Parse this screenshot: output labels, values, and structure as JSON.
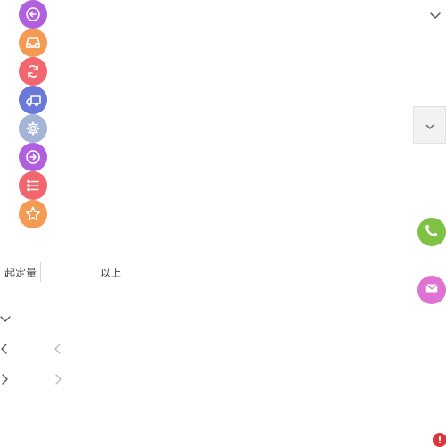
{
  "icon_buttons": [
    {
      "name": "arrow-left-circle-icon",
      "color": "#b05fde"
    },
    {
      "name": "inbox-icon",
      "color": "#f49a52"
    },
    {
      "name": "refresh-icon",
      "color": "#f2666f"
    },
    {
      "name": "truck-icon",
      "color": "#6a78dc"
    },
    {
      "name": "gear-icon",
      "color": "#a4b4d6"
    },
    {
      "name": "arrow-right-circle-icon",
      "color": "#b05fde"
    },
    {
      "name": "list-icon",
      "color": "#f2666f"
    },
    {
      "name": "star-icon",
      "color": "#f49a52"
    }
  ],
  "moq": {
    "label": "起定量",
    "suffix": "以上"
  },
  "floating": {
    "phone_icon": "phone-icon",
    "phone_color": "#7dc242",
    "mail_icon": "mail-icon",
    "mail_color": "#e072d6"
  },
  "alert": {
    "symbol": "!",
    "color": "#e0323a"
  }
}
